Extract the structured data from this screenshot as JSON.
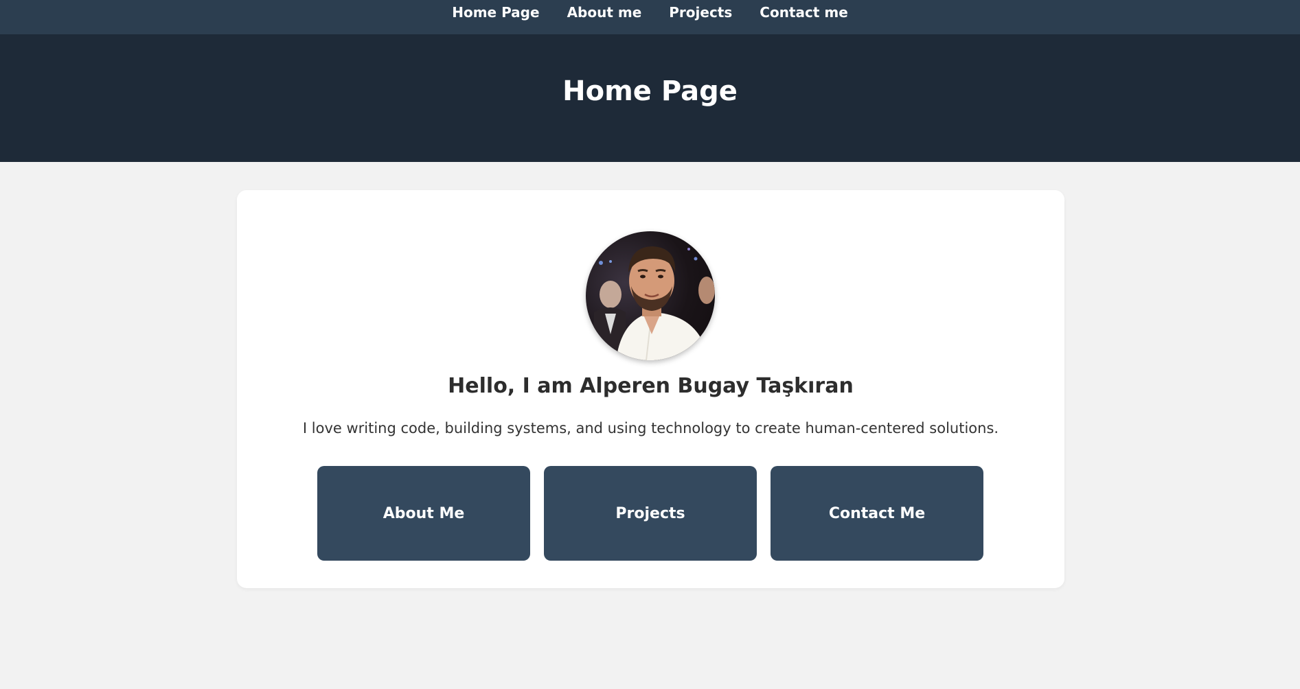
{
  "nav": {
    "items": [
      {
        "label": "Home Page"
      },
      {
        "label": "About me"
      },
      {
        "label": "Projects"
      },
      {
        "label": "Contact me"
      }
    ]
  },
  "header": {
    "title": "Home Page"
  },
  "profile": {
    "greeting": "Hello, I am Alperen Bugay Taşkıran",
    "intro": "I love writing code, building systems, and using technology to create human-centered solutions."
  },
  "buttons": [
    {
      "label": "About Me"
    },
    {
      "label": "Projects"
    },
    {
      "label": "Contact Me"
    }
  ],
  "colors": {
    "nav_bg": "#2c3e50",
    "header_bg": "#1e2a38",
    "button_bg": "#34495e",
    "page_bg": "#f2f2f2"
  }
}
